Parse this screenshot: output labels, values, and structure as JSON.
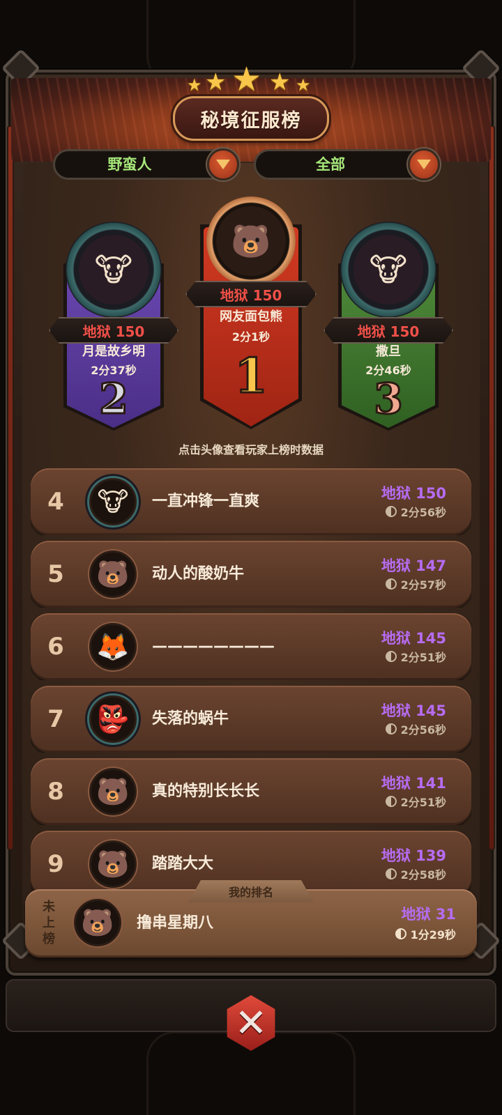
{
  "header": {
    "title": "秘境征服榜"
  },
  "filters": [
    {
      "label": "野蛮人"
    },
    {
      "label": "全部"
    }
  ],
  "podium": [
    {
      "rank": "2",
      "name": "月是故乡明",
      "score": "地狱 150",
      "time": "2分37秒",
      "avatar": "cow-avatar-icon",
      "color": "#5b3a9a"
    },
    {
      "rank": "1",
      "name": "网友面包熊",
      "score": "地狱 150",
      "time": "2分1秒",
      "avatar": "helmet-bear-avatar-icon",
      "color": "#c0301e"
    },
    {
      "rank": "3",
      "name": "撒旦",
      "score": "地狱 150",
      "time": "2分46秒",
      "avatar": "cow-avatar-icon",
      "color": "#3f7a2e"
    }
  ],
  "hint": "点击头像查看玩家上榜时数据",
  "rows": [
    {
      "rank": "4",
      "name": "一直冲锋一直爽",
      "score": "地狱 150",
      "time": "2分56秒",
      "avatar": "cow-avatar-icon"
    },
    {
      "rank": "5",
      "name": "动人的酸奶牛",
      "score": "地狱 147",
      "time": "2分57秒",
      "avatar": "bear-avatar-icon"
    },
    {
      "rank": "6",
      "name": "————————",
      "score": "地狱 145",
      "time": "2分51秒",
      "avatar": "fox-avatar-icon"
    },
    {
      "rank": "7",
      "name": "失落的蜗牛",
      "score": "地狱 145",
      "time": "2分56秒",
      "avatar": "goblin-avatar-icon"
    },
    {
      "rank": "8",
      "name": "真的特别长长长",
      "score": "地狱 141",
      "time": "2分51秒",
      "avatar": "bear-avatar-icon"
    },
    {
      "rank": "9",
      "name": "踏踏大大",
      "score": "地狱 139",
      "time": "2分58秒",
      "avatar": "helmet-bear-avatar-icon"
    }
  ],
  "my_rank": {
    "tab_label": "我的排名",
    "status": "未上榜",
    "name": "撸串星期八",
    "score": "地狱 31",
    "time": "1分29秒",
    "avatar": "helmet-bear-avatar-icon"
  },
  "colors": {
    "score_purple": "#b66cf2",
    "score_red": "#f05048",
    "filter_green": "#a6e87a"
  }
}
